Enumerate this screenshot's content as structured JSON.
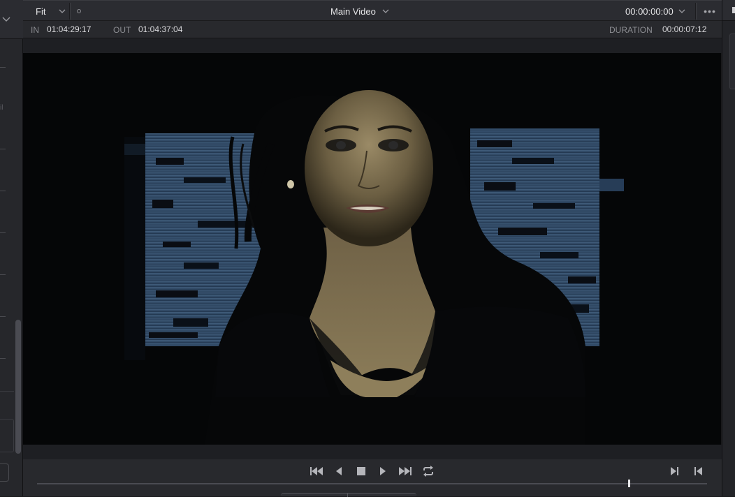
{
  "header": {
    "zoom_mode": "Fit",
    "title": "Main Video",
    "timecode": "00:00:00:00",
    "more": "•••"
  },
  "inout": {
    "in_label": "IN",
    "in_value": "01:04:29:17",
    "out_label": "OUT",
    "out_value": "01:04:37:04",
    "duration_label": "DURATION",
    "duration_value": "00:00:07:12"
  },
  "left_panel": {
    "ghost_text": "il"
  },
  "transport": {
    "buttons": [
      "skip-to-start",
      "step-back",
      "stop",
      "play",
      "skip-to-end",
      "loop",
      "mark-in-nav",
      "mark-out-nav"
    ],
    "playhead_position": 0.883
  },
  "colors": {
    "accent": "#e6e6e8",
    "panel": "#28292d",
    "viewer_bg": "#050607"
  }
}
